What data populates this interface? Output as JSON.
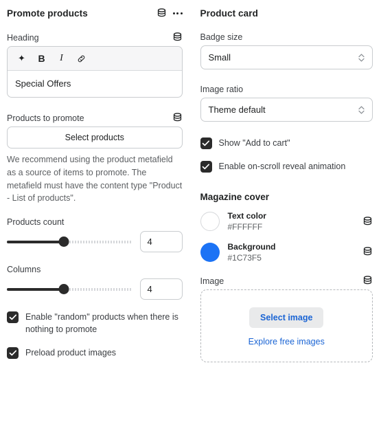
{
  "left": {
    "section_title": "Promote products",
    "icons": {
      "metafield": "database-icon",
      "more": "ellipsis-icon"
    },
    "heading_field": {
      "label": "Heading",
      "metafield_icon": "database-icon",
      "toolbar": [
        {
          "name": "ai-sparkle-icon",
          "glyph": "✦"
        },
        {
          "name": "bold-icon",
          "glyph": "B"
        },
        {
          "name": "italic-icon",
          "glyph": "I"
        },
        {
          "name": "link-icon",
          "glyph": "🔗"
        }
      ],
      "value": "Special Offers"
    },
    "products_field": {
      "label": "Products to promote",
      "metafield_icon": "database-icon",
      "button_label": "Select products",
      "help": "We recommend using the product metafield as a source of items to promote. The metafield must have the content type \"Product - List of products\"."
    },
    "products_count": {
      "label": "Products count",
      "value": "4",
      "percent": 45
    },
    "columns": {
      "label": "Columns",
      "value": "4",
      "percent": 45
    },
    "checkboxes": [
      {
        "label": "Enable \"random\" products when there is nothing to promote",
        "checked": true
      },
      {
        "label": "Preload product images",
        "checked": true
      }
    ]
  },
  "right": {
    "section_title": "Product card",
    "badge_size": {
      "label": "Badge size",
      "value": "Small"
    },
    "image_ratio": {
      "label": "Image ratio",
      "value": "Theme default"
    },
    "checkboxes": [
      {
        "label": "Show \"Add to cart\"",
        "checked": true
      },
      {
        "label": "Enable on-scroll reveal animation",
        "checked": true
      }
    ],
    "magazine_cover": {
      "title": "Magazine cover",
      "colors": [
        {
          "name": "Text color",
          "hex": "#FFFFFF",
          "metafield_icon": "database-icon"
        },
        {
          "name": "Background",
          "hex": "#1C73F5",
          "metafield_icon": "database-icon"
        }
      ],
      "image": {
        "label": "Image",
        "metafield_icon": "database-icon",
        "select_label": "Select image",
        "explore_label": "Explore free images"
      }
    }
  }
}
